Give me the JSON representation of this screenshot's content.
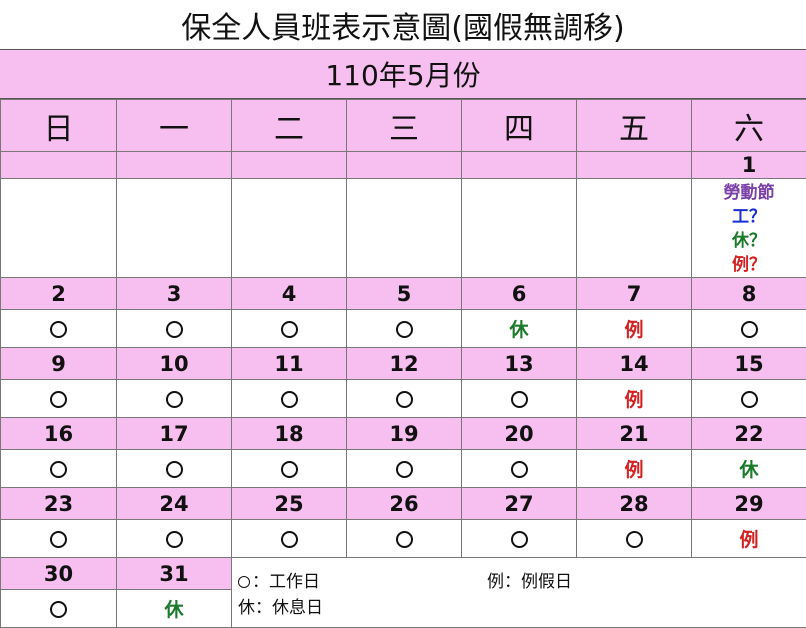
{
  "title": "保全人員班表示意圖(國假無調移)",
  "month_label": "110年5月份",
  "weekdays": [
    "日",
    "一",
    "二",
    "三",
    "四",
    "五",
    "六"
  ],
  "first_week": {
    "day": "1",
    "holiday_name": "勞動節",
    "options": [
      "工？",
      "休？",
      "例？"
    ]
  },
  "weeks": [
    {
      "days": [
        "2",
        "3",
        "4",
        "5",
        "6",
        "7",
        "8"
      ],
      "marks": [
        "circle",
        "circle",
        "circle",
        "circle",
        "休",
        "例",
        "circle"
      ]
    },
    {
      "days": [
        "9",
        "10",
        "11",
        "12",
        "13",
        "14",
        "15"
      ],
      "marks": [
        "circle",
        "circle",
        "circle",
        "circle",
        "circle",
        "例",
        "circle"
      ]
    },
    {
      "days": [
        "16",
        "17",
        "18",
        "19",
        "20",
        "21",
        "22"
      ],
      "marks": [
        "circle",
        "circle",
        "circle",
        "circle",
        "circle",
        "例",
        "休"
      ]
    },
    {
      "days": [
        "23",
        "24",
        "25",
        "26",
        "27",
        "28",
        "29"
      ],
      "marks": [
        "circle",
        "circle",
        "circle",
        "circle",
        "circle",
        "circle",
        "例"
      ]
    },
    {
      "days": [
        "30",
        "31"
      ],
      "marks": [
        "circle",
        "休"
      ]
    }
  ],
  "legend": {
    "work": "：工作日",
    "rest": "休：休息日",
    "regular_off": "例：例假日"
  },
  "colors": {
    "header_bg": "#f7bff0",
    "rest": "#1a7a2a",
    "regular_off": "#d42020",
    "holiday": "#7b3fa8",
    "work_option": "#1a2fd6"
  }
}
